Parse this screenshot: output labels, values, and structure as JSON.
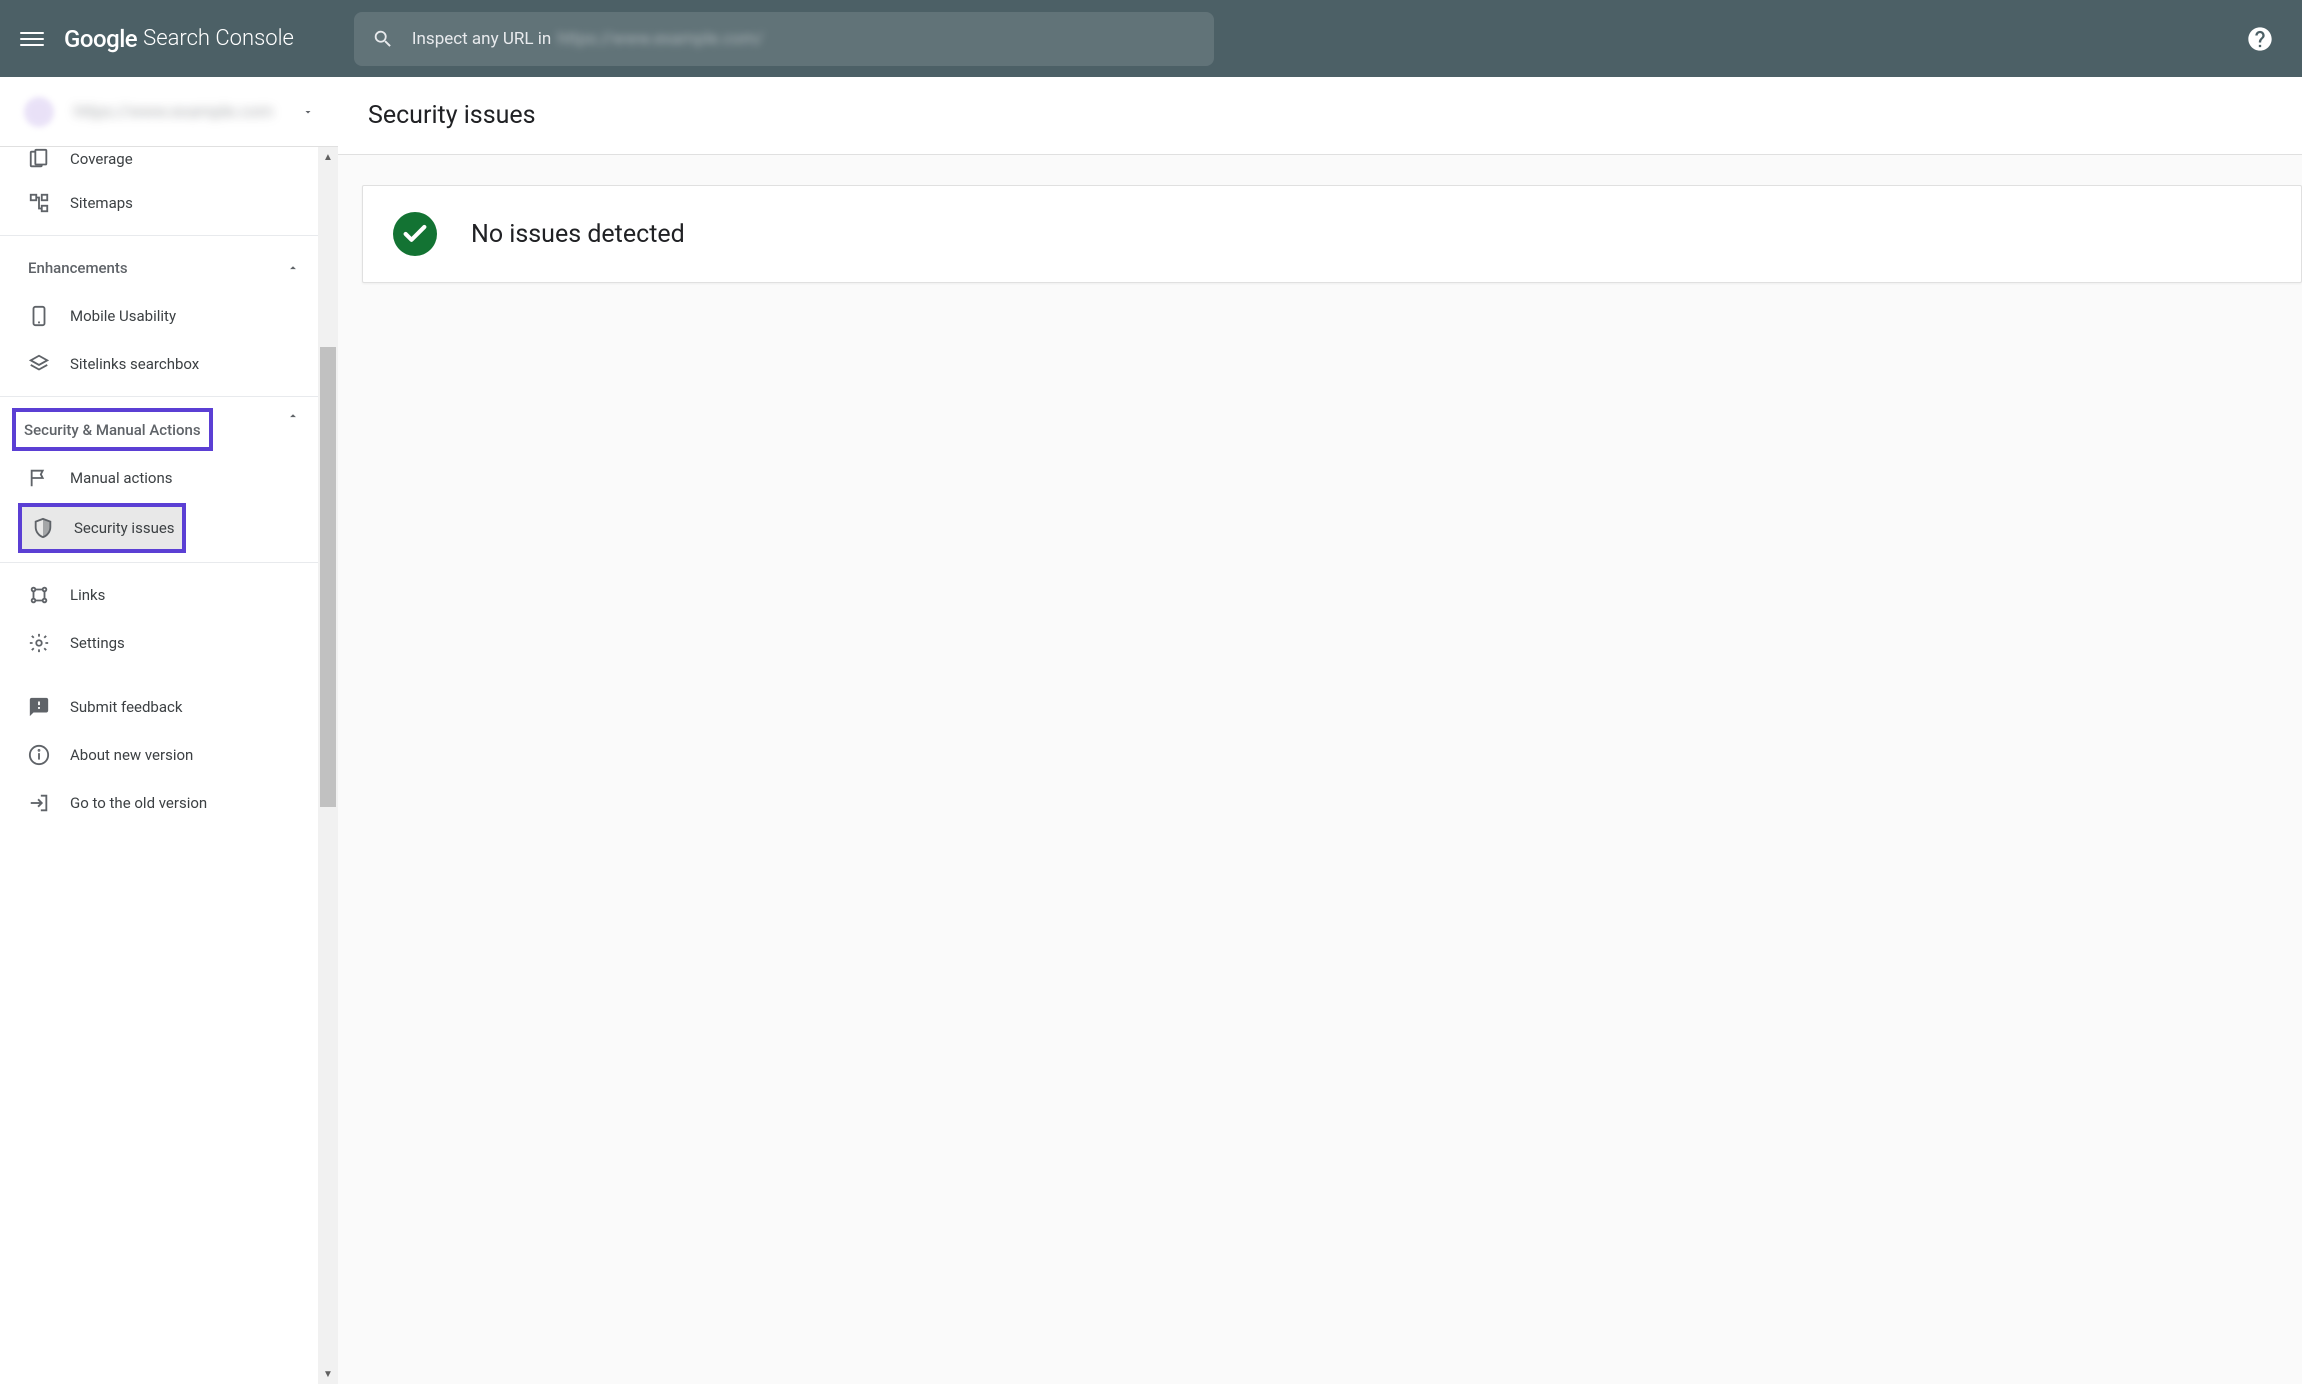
{
  "header": {
    "logo_brand": "Google",
    "logo_product": "Search Console",
    "search_placeholder_prefix": "Inspect any URL in",
    "search_placeholder_blur": "https://www.example.com/"
  },
  "sidebar": {
    "property_name": "https://www.example.com",
    "items_top": {
      "coverage": "Coverage",
      "sitemaps": "Sitemaps"
    },
    "section_enhancements": {
      "title": "Enhancements",
      "mobile_usability": "Mobile Usability",
      "sitelinks_searchbox": "Sitelinks searchbox"
    },
    "section_security": {
      "title": "Security & Manual Actions",
      "manual_actions": "Manual actions",
      "security_issues": "Security issues"
    },
    "items_bottom": {
      "links": "Links",
      "settings": "Settings",
      "submit_feedback": "Submit feedback",
      "about_new_version": "About new version",
      "go_to_old_version": "Go to the old version"
    }
  },
  "main": {
    "page_title": "Security issues",
    "status_message": "No issues detected"
  }
}
